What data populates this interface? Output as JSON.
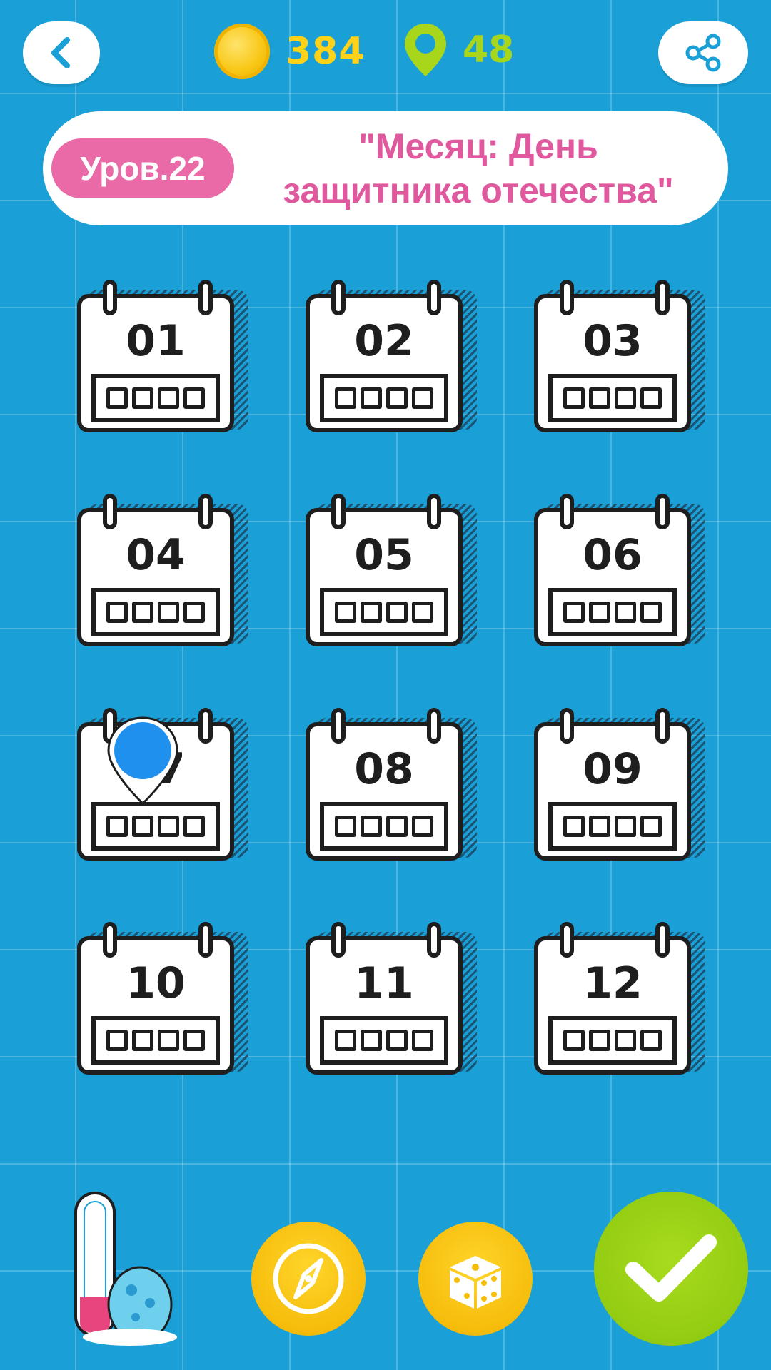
{
  "top_bar": {
    "coins": "384",
    "hints": "48",
    "back_icon": "chevron-left-icon",
    "share_icon": "share-icon"
  },
  "level": {
    "badge": "Уров.22",
    "title_line1": "\"Месяц: День",
    "title_line2": "защитника отечества\""
  },
  "months": [
    {
      "label": "01"
    },
    {
      "label": "02"
    },
    {
      "label": "03"
    },
    {
      "label": "04"
    },
    {
      "label": "05"
    },
    {
      "label": "06"
    },
    {
      "label": "07"
    },
    {
      "label": "08"
    },
    {
      "label": "09"
    },
    {
      "label": "10"
    },
    {
      "label": "11"
    },
    {
      "label": "12"
    }
  ],
  "colors": {
    "background": "#1aa0d6",
    "coin_text": "#ffd21a",
    "hint_text": "#a8d61a",
    "badge": "#ea6aa8",
    "title": "#e0589e",
    "confirm": "#93cc12",
    "round_button": "#f6bd0c"
  },
  "bottom_bar": {
    "thermometer_icon": "thermometer-icon",
    "compass_icon": "compass-icon",
    "dice_icon": "dice-icon",
    "confirm_icon": "checkmark-icon"
  }
}
